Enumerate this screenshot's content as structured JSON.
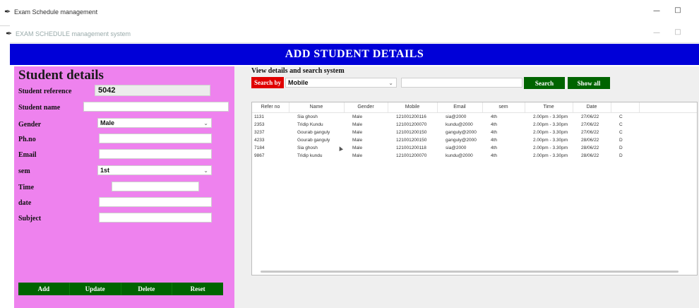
{
  "window": {
    "title": "Exam Schedule management",
    "inner_title": "EXAM SCHEDULE management system",
    "minimize_glyph": "—",
    "maximize_glyph": "□",
    "icon_glyph": "✒"
  },
  "banner": {
    "title": "ADD STUDENT DETAILS"
  },
  "student_form": {
    "title": "Student details",
    "fields": {
      "reference": {
        "label": "Student reference",
        "value": "5042"
      },
      "name": {
        "label": "Student name",
        "value": ""
      },
      "gender": {
        "label": "Gender",
        "value": "Male"
      },
      "phone": {
        "label": "Ph.no",
        "value": ""
      },
      "email": {
        "label": "Email",
        "value": ""
      },
      "sem": {
        "label": "sem",
        "value": "1st"
      },
      "time": {
        "label": "Time",
        "value": ""
      },
      "date": {
        "label": "date",
        "value": ""
      },
      "subject": {
        "label": "Subject",
        "value": ""
      }
    },
    "buttons": {
      "add": "Add",
      "update": "Update",
      "delete": "Delete",
      "reset": "Reset"
    }
  },
  "search": {
    "title": "View details and search system",
    "search_by_label": "Search by",
    "search_by_value": "Mobile",
    "search_text": "",
    "search_button": "Search",
    "show_all_button": "Show all"
  },
  "table": {
    "columns": [
      "Refer no",
      "Name",
      "Gender",
      "Mobile",
      "Email",
      "sem",
      "Time",
      "Date",
      ""
    ],
    "rows": [
      [
        "1131",
        "Sia ghosh",
        "Male",
        "121001200116",
        "sia@2000",
        "4th",
        "2.00pm - 3.30pm",
        "27/06/22",
        "C"
      ],
      [
        "2353",
        "Tridip Kundu",
        "Male",
        "121001200070",
        "kundu@2000",
        "4th",
        "2.00pm - 3.30pm",
        "27/06/22",
        "C"
      ],
      [
        "3237",
        "Gourab ganguly",
        "Male",
        "121001200150",
        "ganguly@2000",
        "4th",
        "2.00pm - 3.30pm",
        "27/06/22",
        "C"
      ],
      [
        "4233",
        "Gourab ganguly",
        "Male",
        "121001200150",
        "ganguly@2000",
        "4th",
        "2.00pm - 3.30pm",
        "28/06/22",
        "D"
      ],
      [
        "7184",
        "Sia ghosh",
        "Male",
        "121001200118",
        "sia@2000",
        "4th",
        "2.00pm - 3.30pm",
        "28/06/22",
        "D"
      ],
      [
        "9867",
        "Tridip kundu",
        "Male",
        "121001200070",
        "kundu@2000",
        "4th",
        "2.00pm - 3.30pm",
        "28/06/22",
        "D"
      ]
    ]
  },
  "colors": {
    "banner": "#0000d8",
    "left_panel": "#ee82ee",
    "green_button": "#006400",
    "red_label": "#e00000"
  }
}
